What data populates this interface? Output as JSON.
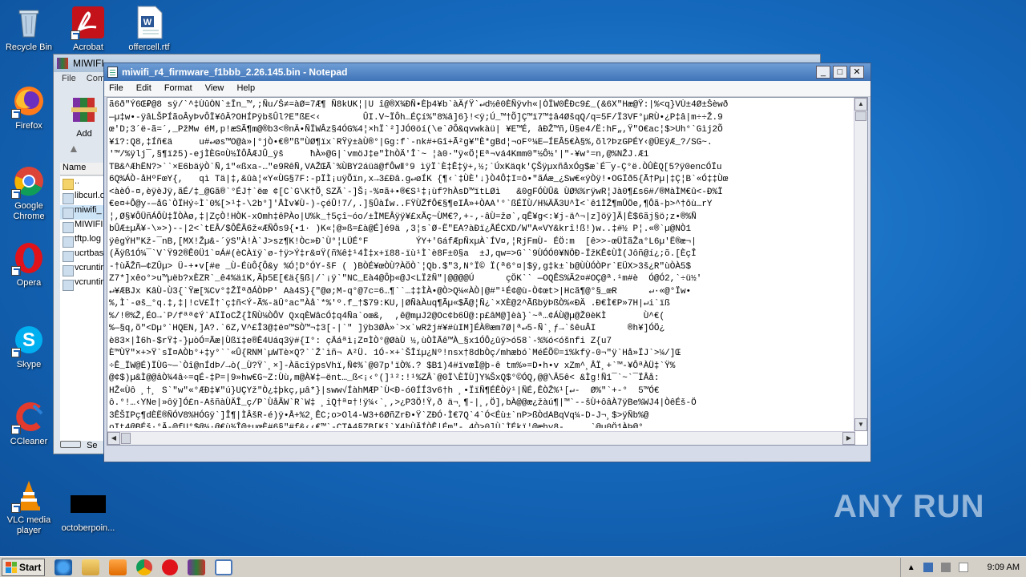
{
  "desktop": {
    "icons": [
      {
        "label": "Recycle Bin"
      },
      {
        "label": "Acrobat"
      },
      {
        "label": "offercell.rtf"
      },
      {
        "label": "Firefox"
      },
      {
        "label": "Google Chrome"
      },
      {
        "label": "Opera"
      },
      {
        "label": "Skype"
      },
      {
        "label": "CCleaner"
      },
      {
        "label": "VLC media player"
      },
      {
        "label": "octoberpoin..."
      }
    ]
  },
  "winrar": {
    "title": "MIWIFI",
    "menu": [
      "File",
      "Com"
    ],
    "add_label": "Add",
    "column_name": "Name",
    "files": [
      "..",
      "libcurl.o",
      "miwifi_",
      "MIWIFI",
      "tftp.log",
      "ucrtbas",
      "vcruntir",
      "vcruntir"
    ],
    "status": "Se"
  },
  "notepad": {
    "title": "miwifi_r4_firmware_f1bbb_2.26.145.bin - Notepad",
    "menu": [
      "File",
      "Edit",
      "Format",
      "View",
      "Help"
    ],
    "buttons": {
      "minimize": "_",
      "maximize": "□",
      "close": "✕"
    },
    "content": [
      "ã6ð\"Ý6Œ₽@8 sÿ/`^‡ÙûÒN`±Īn_™,;Ñu/Š≠=àØ=7Æ¶ Ñ8kUK¦|U î@®X¾ÐÑ•Èþ4¥b`àÄƒŸ`↵d½ê0ÈÑÿvh«|ÒÏW0ÊÐc9£_(&6X\"Hæ@Ÿ:|%<q}VÙ±4Ø±Šèwð",
      "—µ‡w•-ÿâLŠPÍãoÂyÞvÔÏ¥ôÄ?OHÍPÿbšÛl?E\"ßE<‹        ÛI.V~ÏÔh…ÉÇí%\"8%â]6}!<ÿ;Ú_™†Õ]Ç™ï7™‡â4ØšqQ/q=5F/Ï3VF°µRÙ•¿P‡â|m÷÷Ž.9",
      "œ'D;3´ë-ã=´,_PžMw éM,p!æSÃ¶m@®b3<®nÄ•ÑÏWÂz§4ÓG%4¦×hÏ`²]JÓ0öí(\\e`∂Ô&qvwkàü| ¥E™É, âÐŽ™ñ,Ü§e4/Ë:hF„,Ÿ\"O€ac¦$>Uh°`Gìj2Õ",
      "¥î?:Q8,‡Íñ€ä     u#↵øs™O@à»|°jÒ•€®\"ß\"ÙØ¶ïx`RŸÿ±àÙ®°|Gg:f`-nk#+Gî+Ã²g¥\"È*gBd¦¬oFº¼E—ÍEÂ5€À§%,õl?ÞzGPÉY‹@ÜEÿÆ_?/SG~.",
      "'™/%ÿlj¯,§¶ïž5)-ejÌÈG¤Ù½ÏÔÂÆJÛ_ÿš     ħÀ»@G|`vmöJ‡e\"ÌhÒÄ'Î`~ ¦à0·\"ÿ«Ö¦Eª¬vá4Kmm0\"½Ô½'|\"-¥w°=n,@%NŽJ.Æ1",
      "TB&^ÆhËN?>``×E6bäÿÒ`Ñ,1\"«ßxa-…\"e9RêÑ,VAŽŒÃ`%ÙBY2áüä@fÔwⅡ°9 ìÿÏ`È‡Ê‡ÿ+,½;`ÚxKäqk'ÇŠÿµxñåxÓg$æ`É¯y-Ç°ë.ÒÛÈQ[5?ÿ0encÓÏu",
      "6Q%ÁÒ-åHºFœY{,   qì Tä|‡,&ûà¦«Y«ÙG§7F:-pÏÌ¡uÿÕïn,x→3£Ðâ.g↵øÍK {¶‹`‡ÙÈ'↓}Ò4Ô‡I=ô•\"ãÁæ_¿Sw€«ÿÒÿ!•OGÏð5{Ã†Pµ|‡Ç¦B`«Ó‡‡Ùœ",
      "<àèÓ-¤,èÿèJÿ,ãÉ/‡_@Gã®`°ÉJ†`ëœ ¢[C`G\\K†Õ¸SZÃ`-]Š¡-%¤ã+•®€S¹‡¡ùf?hÀsD™ïtLØì   &0gFÓÙÛ& ÙØ%%rÿwR¦Jà0¶£s6#/®MàÌM€û<-Ð%Ï",
      "€e¤+Ô@y-—åG`ÒÏHý÷Ì`0%[>¹‡-\\2b°]'ÅÌv¥Ù-)-çéÛ!7/,.]§ÛàÍw..FŸÙŽfÔ€§¶eIÅ»+ÒAA'°`ßÉÏÙ/H¾ÄÃ3U^Ì<`ê1ÌŽ¶mÛÖe,¶Ôã-þ>^†ôù…rY",
      "¦,Ø§¥ÔÜñÁÔÙ‡ÏÒÀø,‡|ZçÒ!HÒK-xOmh‡êPÀo|U%k_†5çî~óo/±ÌMEÂÿÿ¥£xÃç~ÙM€?,+-‚-âÙ=žø`,qÊ¥g<:¥j-ä^¬|z]öÿ]Ã|È$6ãj§ö;z•®%Ñ",
      "bÛÆ±µÃ¥-\\»>)--|2<`tEÂ/$ÔÊÃ6ž«ÆÑÔs9{•1· )K«¦@»ß=£à@É]é9ä ,3¦s`Ø-Ë\"EA?àÐï¿ÅÉCXD/W\"A«VY&krî!ß!)w..‡#½ P¦.«®`µ@NÒ1",
      "ÿêgÝH\"Kž-¯nB,[MX!Žµ&-´ÿS\"À!À`J>sz¶K!Òc»Ð`Ù°¦LÜÉ°F         ÝY+'GáfÆpÑxµÀ`ÍV¤,¦RjFmÙ- ÉÖ:m  [ê>>-œÜÌãŽa°L6µ'Ë®æ¬|",
      "(Ãÿß1Ó¼¯`V`Ÿ92®Ê0Ü1`¤Á#(èCÀïÿ`ø-†ÿ>Ý‡r&¤Ÿ(ñ%ê‡¹4Ì‡x+ï88-ïù¹Ì`è8F±0§a  ±J,qw=>G``9ÙÓÓ0¥NÖÐ-ÏžKÊ¢ÙÌ(Jôñ@í¿;õ.[ÈçÎ",
      "-†ùÃŽñ—¢ZÛµ> Ü-+•v[#e _Ù-ÉùÔ{Ô&y %Ó¦D°ÓY-šF ( )BÒÉ¥œÒÙ?ÀÖÒ`¦Qb.$\"3,N°Ï© Ï(ª6°¤|$ÿ,g‡k±`b@ÙÙÓÒPr`EÜX>3š¿R\"ùÒÀ5$",
      "Z7*]xêo°>u™µëb?xÈZR`_ê4%äïK,Ãþ5E[€ä{§ß|/`¡ÿ`\"NC_Eà4@Ôþ«@J<LÏžÑ\"|@@@@Ú      çÖK`` —OQÊS%Ã2¤#OÇ@ª.¹m#è  Ó@Ó2,`÷ü½'",
      "↵¥ÆBJx KâÙ-Ù3{`Ÿæ[%Cv°‡ŽÏªðÁÒÞP' Aà4S}{\"@ø;M-q°@7c=6…¶``…‡‡ÌÀ•@Ò>Q¼«ÀÒ|@#\"¹É¢@ù-Ò¢œt>|Hcã¶@°§_œR      ↵·«@°Ïw•",
      "%,Ì`-øš_°q.‡,‡|!cV£Ï†`ç‡ñ<Ý-Ã%-äÜ°ac\"Àå`*%'º.f_†$79:KU,|ØÑàÀuq¶Ãµ«$Ã@¦Ñ¿`×XÈ@2^ÃßbÿÞßÒ%«ÐÄ .Ð€Ì€P»7H|↵i`ïß",
      "%/!®%Ž,ÉO→`P/fªª¢Ý`AÏÏoCŽ{ÌÑÙ¼ÒÔV QxqÈWâcÓ‡q4Ña`oœ&,  ,ê@mµJ2@Oc¢b6Ü@:p£âM@]èà}`~ª…¢ÁÙ@µ@Ž0èKÌ       Ù^€(",
      "%—§q,õ\"<Dµ°`HQEN,]A?.`6Z,V^£Î3@‡ë¤™SÒ™¬‡3[-|`\" ]ÿb3ØÀ»`>x`wRžj#¥#ùIM]ÉÀ®æm7Ø|ª↵5-Ñ`¸ƒ→`šêuÂI      ®h¥]ÓÖ¿",
      "è83×|Ì6h-$rŸ‡-}µòÓ=Ãæ|Ùßï‡e®Ê4Uáq3ÿ#{I°: çÄáªì¡Z¤ÌÒ°@ØàÙ ½,ùÒÌÃê™À_§x1ÓÔ¿ûÿ>ó58`-%%ó<óšnfi Z{u7",
      "È™ÙŸ\"×+>Ÿ`sÏ¤AÒb°+‡y°``«Û{RNM`µWTè×Q?``Ž`ìñ¬ A²Ü. 1Ó-×+`ŠÎïµ¿Nº!nsx†8dbÒç/mhæbó`MéÉÕ©=ï%kfÿ-0¬\"ÿ`Hå»ÏJ`>¼/]Œ",
      "÷Ê_ÏW@É)ÏÙG~—`Òî@nÍdÞ/→ò(_Ù?Ÿ`¸×]-ÀãcîÿpsVhï,Ñ¢%`@07p'ïÒ%.? $B1)4#ïvœÌ@þ-ê tm%»=D•h•v xZm^¸ÂÏ¸+`™-¥ÔªÀÜ‡`Ÿ%",
      "@¢$)µ&Ì@@âÒ¾4â÷=qÉ-‡P=|9»hw€G~Z:Ùù,m@À¥‡—ënt…_ß<¡‹°(]¹²:!¹%ZÂ`@0Ï\\ÈÏÙ]Y¾ŠxQ$°©ÓQ,@@\\Â5ê< &Ìg!Ñ1¯`~`¯ÏÂå:",
      "HŽ«Ùô ¸†¸ S`\"w\"«°ÆÐ‡¥\"ú}UÇYž\"Ò¿‡þkç,µâ*}|sww√ÍàhMÆP`Ù<Ð-ó0ÍÍ3v6†h ¸•ÏïÑ¶ÉÊÒÿ¹|ÑÉ,ÊÒŽ%¹[↵-  Ø%\"`+-°  5™Ó€",
      "ô.°!…‹YNe|»ôÿ]Ó£n-AšñàÙÄÎ_ç/P`ÙåÃW`R`W‡ ¸iQ†ª¤†!ÿ¼‹`¸,>¿P3Ö!Ÿ,ð ä¬¸¶-|¸,Ö],bÀ@@æ¿žàú¶|™`--šÙ+ôâÀ7ÿBe%WJ4|ÒêÉš-Ö",
      "3ÊŠIPç¶dÈË®ÑÓV8%HÓGÿ`]Î¶|ÌÂšR-é)ÿ•Å+%2¸ÊC;o>Ol4-W3+6ØñZrÐ•Ÿ`ZÐÓ·Ì€7Q`4`Ó<Éù±`nP>ßÒdABqVq¼-D-J¬¸$>ÿÑb%@",
      "oIt4@BÉš·°Ã-@fU°$@¼·@€ù¾Î@±µœÈ#6§\"#f&‹‹€™`-CTA4§ZB[Kî`X4bÙÃÍÒÊ|Ém\"- 4Ò>0]Ù`ÌÉkï¦@æhy8-     `@µ0Ö1ÀÞ@°",
      "Ï5Ì²uo.Hy…g_ŽI¢44¥Ùå <-`Ï @ã1ã_ÌÌã‡±_Ì¢ÆqUÃ\"ðvM¦`Ì<C¡@ùÓÔ%@@vm¦`Í<Ç…@ÓÓ\"0ìÊJàÓ‡@MÉTÏ»@±ÌÒµ@Ò?>`Z",
      "qÿ   ©€(|'ÿ4^·\"«P‡¸!»%²€àw¸m€{fÛ‡{]^»pÇÈÌ1q@Ò0@>PÀÙ/-ÉØ]`Ž4|3m@Ìa¶4Ì,ç,Ù™`|WØ«‡»`      »8Ò    %ÖÜÿKÛ±",
      "•P½ ¤+Ðó;{àv°Ó`G§ÏÇÒ ©‡k¸ä4±£ÆqÌ,,ŸR²@œ€·Ìwq%®@24gxQ ì_Ôh|\"½è=ñ%è6,_nÏ`H°ow|«à¦§ê7gö%\"$@°I¼¸Ë`Ú!xà%¼",
      "Ó4¾ÿÒ»Y£¤°ÁJ=ÿ¶Ã>»¸@ñ``‡•¸Gïy>ìÁ¢0Çd70ä|'ŘÀÒ4k*Ã`»-Þ,6ÒfÃÀQ`¾ä\"w`ìÌ{Êž•ff`ê0vÍóÌÓÉæ%,ëyFb(4°¤[â Ü,H°ÿ@2",
      "ï¿-,¼Ò|ä€rÉÓŽÈÐ°ÙnÌNÌ…<‡Mc‡:}y=Ÿ@) LÙ=BÒûsxâ,ÉTž\\.7#E%-`äWTÌ›Ê4¢à|pWk/ÓÙX4Ù-½A(s‡m@ÙR`žµ2†•`°Gm‡à("
    ]
  },
  "watermark": "ANY RUN",
  "taskbar": {
    "start_label": "Start",
    "clock": "9:09 AM"
  }
}
